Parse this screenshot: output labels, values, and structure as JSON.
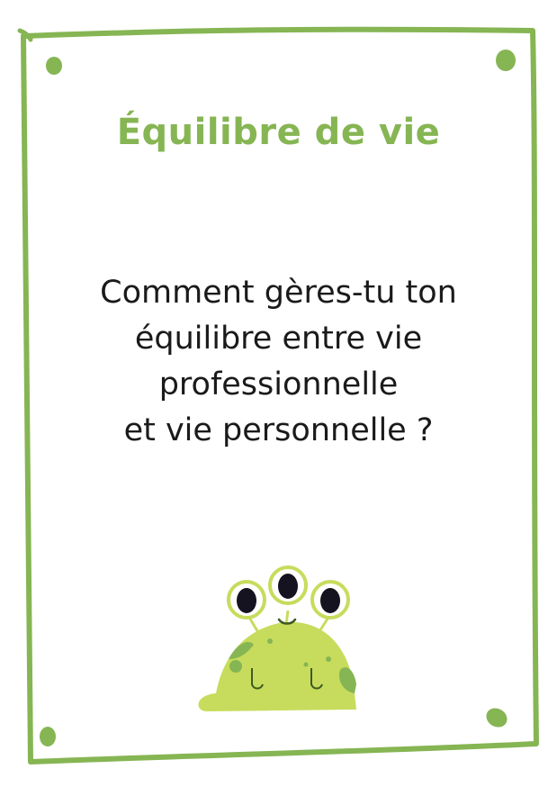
{
  "card": {
    "title": "Équilibre de vie",
    "question_lines": [
      "Comment gères-tu ton",
      "équilibre entre vie",
      "professionnelle",
      "et vie personnelle ?"
    ],
    "accent_color": "#86b553",
    "mascot_color": "#c7dc5c",
    "mascot_icon": "three-eyed-alien-slug"
  }
}
